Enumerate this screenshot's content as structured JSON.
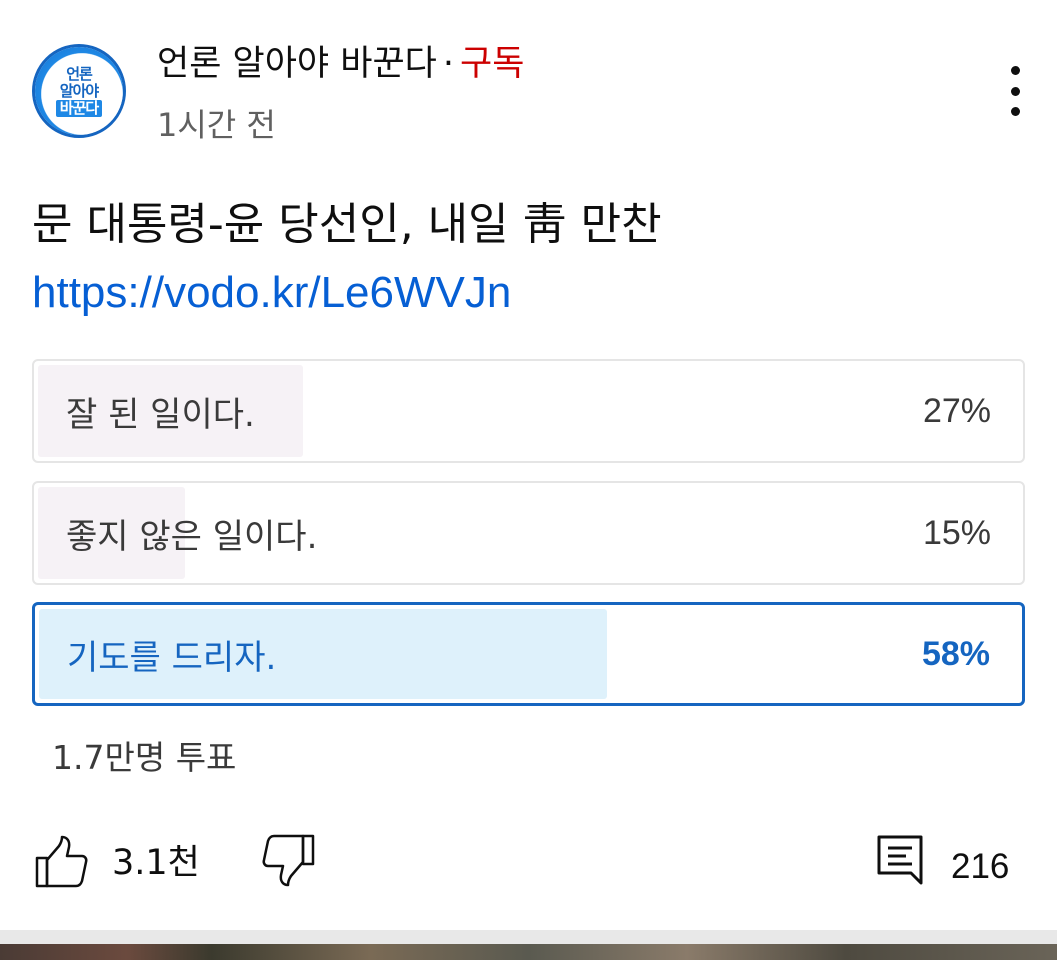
{
  "channel": {
    "avatar_lines": [
      "언론",
      "알아야",
      "바꾼다"
    ],
    "name": "언론 알아야 바꾼다",
    "separator": "·",
    "subscribe_label": "구독",
    "time_ago": "1시간 전"
  },
  "post": {
    "title": "문 대통령-윤 당선인, 내일 靑 만찬",
    "link": "https://vodo.kr/Le6WVJn"
  },
  "poll": {
    "options": [
      {
        "label": "잘 된 일이다.",
        "percent_text": "27%",
        "percent": 27,
        "selected": false
      },
      {
        "label": "좋지 않은 일이다.",
        "percent_text": "15%",
        "percent": 15,
        "selected": false
      },
      {
        "label": "기도를 드리자.",
        "percent_text": "58%",
        "percent": 58,
        "selected": true
      }
    ],
    "votes_text": "1.7만명 투표"
  },
  "actions": {
    "likes": "3.1천",
    "comments": "216"
  },
  "colors": {
    "subscribe": "#cc0000",
    "link": "#065fd4",
    "selected": "#1565c0",
    "selected_fill": "#def1fb",
    "fill": "#f6f2f6"
  },
  "icons": [
    "more-vert-icon",
    "thumb-up-icon",
    "thumb-down-icon",
    "comment-icon"
  ]
}
